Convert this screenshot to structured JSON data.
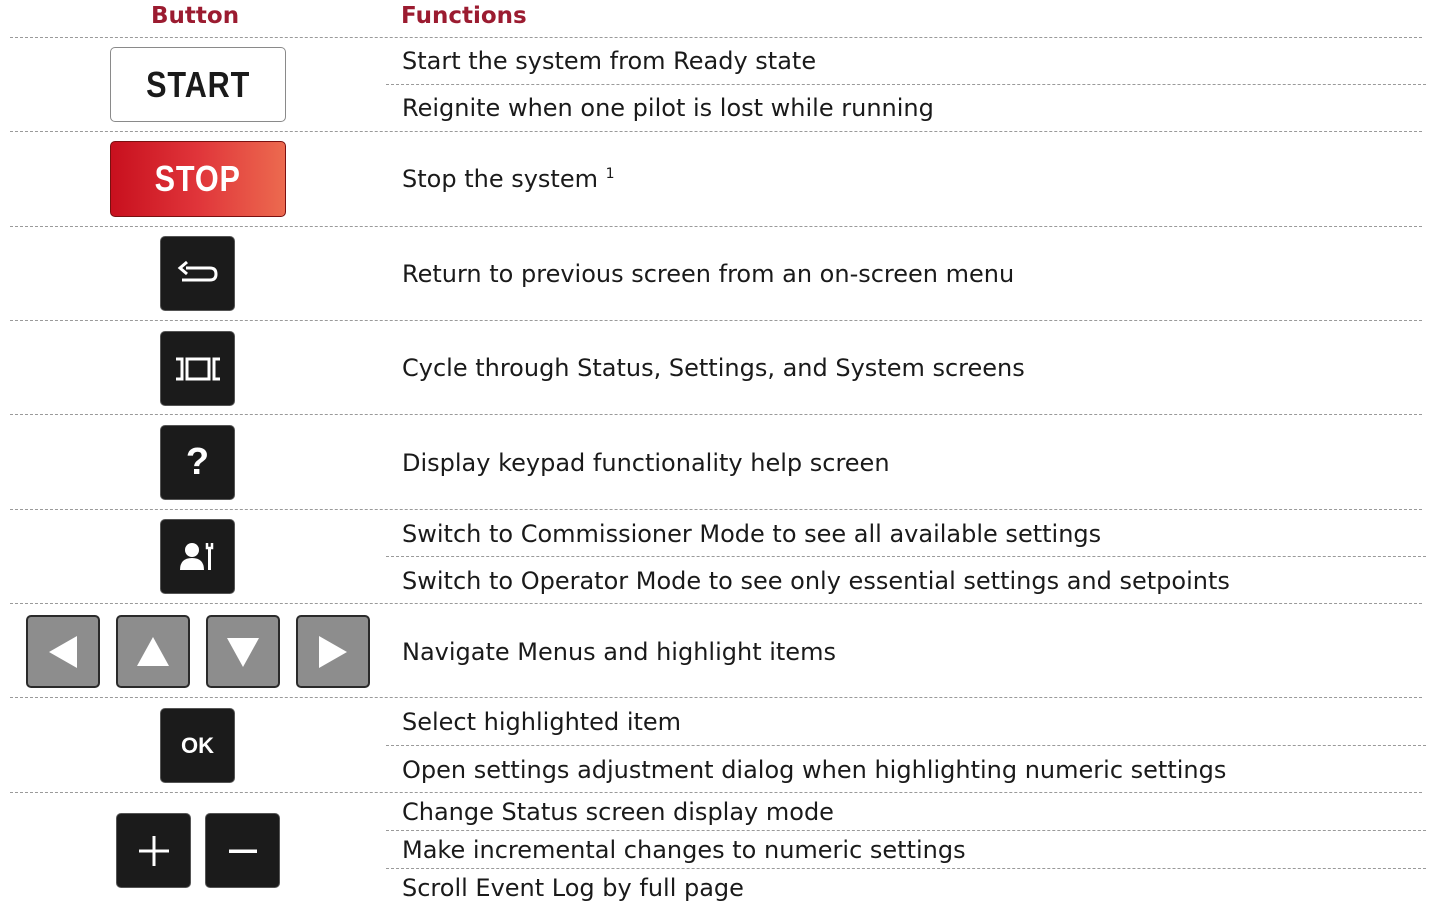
{
  "header": {
    "button_col": "Button",
    "functions_col": "Functions"
  },
  "rows": [
    {
      "button": {
        "label": "START",
        "icon": "start-button"
      },
      "functions": [
        "Start the system from Ready state",
        "Reignite when one pilot is lost while running"
      ]
    },
    {
      "button": {
        "label": "STOP",
        "icon": "stop-button"
      },
      "functions": [
        "Stop the system"
      ],
      "footnote": "1"
    },
    {
      "button": {
        "icon": "back-arrow-icon"
      },
      "functions": [
        "Return to previous screen from an on-screen menu"
      ]
    },
    {
      "button": {
        "icon": "screen-cycle-icon"
      },
      "functions": [
        "Cycle through Status, Settings, and System screens"
      ]
    },
    {
      "button": {
        "label": "?",
        "icon": "help-icon"
      },
      "functions": [
        "Display keypad functionality help screen"
      ]
    },
    {
      "button": {
        "icon": "mode-switch-icon"
      },
      "functions": [
        "Switch to Commissioner Mode to see all available settings",
        "Switch to Operator Mode to see only essential settings and setpoints"
      ]
    },
    {
      "button": {
        "icon": "arrow-keys-icons"
      },
      "functions": [
        "Navigate Menus and highlight items"
      ]
    },
    {
      "button": {
        "label": "OK",
        "icon": "ok-button"
      },
      "functions": [
        "Select highlighted item",
        "Open settings adjustment dialog when highlighting numeric settings"
      ]
    },
    {
      "button": {
        "icon": "plus-minus-icons"
      },
      "functions": [
        "Change Status screen display mode",
        "Make incremental changes to numeric settings",
        "Scroll Event Log by full page"
      ]
    }
  ],
  "colors": {
    "header": "#9b1b30",
    "stop_red": "#c8101e",
    "key_dark": "#1b1b1b",
    "key_gray": "#8d8d8d"
  }
}
